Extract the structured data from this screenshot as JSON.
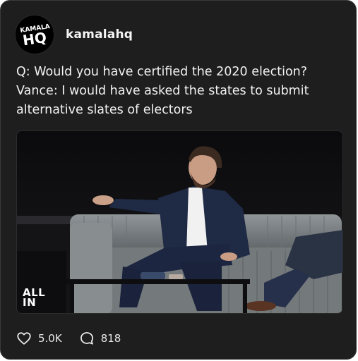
{
  "post": {
    "avatar_text_top": "KAMALA",
    "avatar_text_bottom": "HQ",
    "username": "kamalahq",
    "text": "Q: Would you have certified the 2020 election?\nVance: I would have asked the states to submit\nalternative slates of electors",
    "media": {
      "watermark_line1": "ALL",
      "watermark_line2": "IN"
    },
    "likes": "5.0K",
    "comments": "818"
  },
  "icons": {
    "like": "heart-icon",
    "comment": "comment-bubble-icon"
  },
  "colors": {
    "card_bg": "#1e1e1e",
    "text": "#f2f2f2",
    "border": "#3a3a3a"
  }
}
